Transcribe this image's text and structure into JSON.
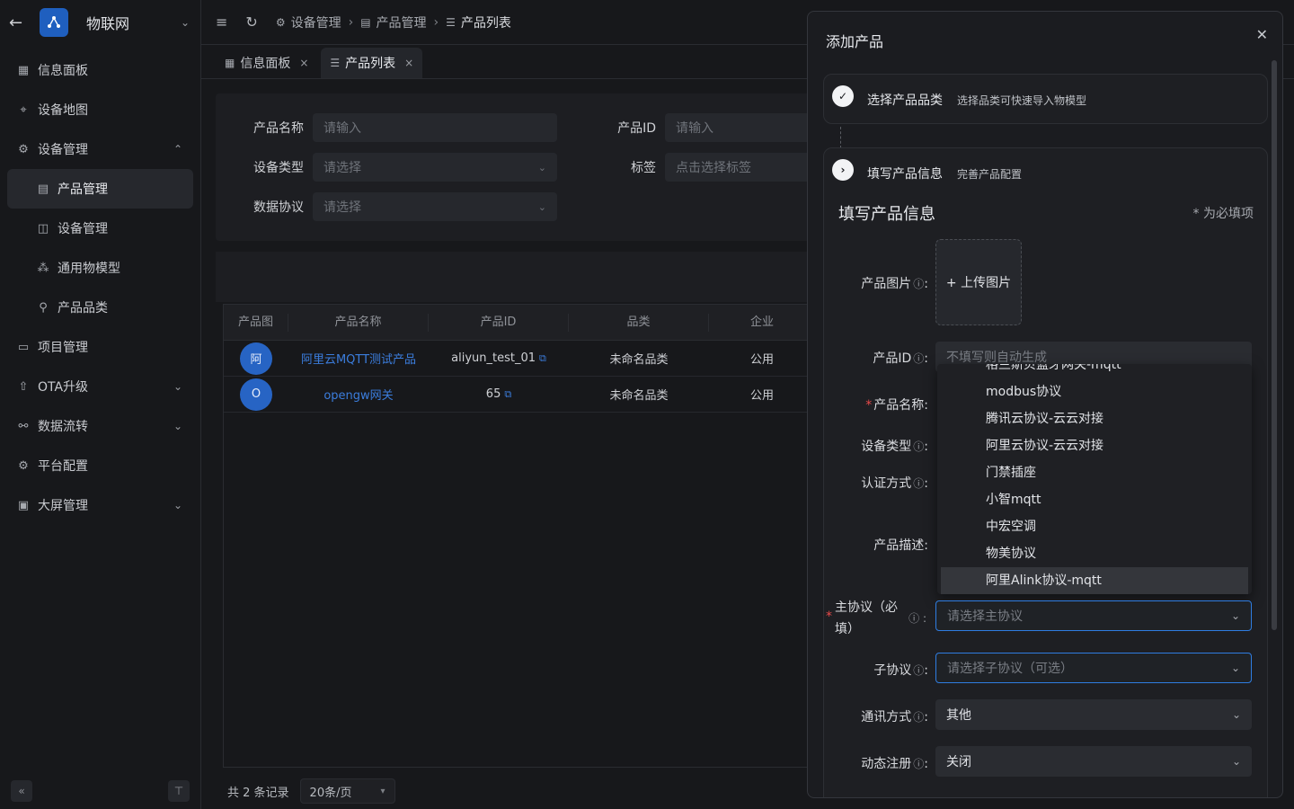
{
  "app": {
    "name": "物联网"
  },
  "sidebar": {
    "items": [
      {
        "label": "信息面板",
        "icon": "dashboard-icon"
      },
      {
        "label": "设备地图",
        "icon": "map-icon"
      },
      {
        "label": "设备管理",
        "icon": "gear-icon"
      },
      {
        "label": "产品管理",
        "icon": "product-icon"
      },
      {
        "label": "设备管理",
        "icon": "device-icon"
      },
      {
        "label": "通用物模型",
        "icon": "model-icon"
      },
      {
        "label": "产品品类",
        "icon": "category-icon"
      },
      {
        "label": "项目管理",
        "icon": "briefcase-icon"
      },
      {
        "label": "OTA升级",
        "icon": "upgrade-icon"
      },
      {
        "label": "数据流转",
        "icon": "flow-icon"
      },
      {
        "label": "平台配置",
        "icon": "settings-icon"
      },
      {
        "label": "大屏管理",
        "icon": "screen-icon"
      }
    ]
  },
  "breadcrumb": {
    "level1": "设备管理",
    "level2": "产品管理",
    "level3": "产品列表"
  },
  "tabs": [
    {
      "label": "信息面板"
    },
    {
      "label": "产品列表"
    }
  ],
  "filter": {
    "name_label": "产品名称",
    "name_ph": "请输入",
    "id_label": "产品ID",
    "id_ph": "请输入",
    "type_label": "设备类型",
    "type_ph": "请选择",
    "tag_label": "标签",
    "tag_ph": "点击选择标签",
    "proto_label": "数据协议",
    "proto_ph": "请选择"
  },
  "table": {
    "headers": [
      "产品图",
      "产品名称",
      "产品ID",
      "品类",
      "企业"
    ],
    "rows": [
      {
        "avatar": "阿",
        "name": "阿里云MQTT测试产品",
        "id": "aliyun_test_01",
        "category": "未命名品类",
        "org": "公用"
      },
      {
        "avatar": "O",
        "name": "opengw网关",
        "id": "65",
        "category": "未命名品类",
        "org": "公用"
      }
    ]
  },
  "pager": {
    "total": "共 2 条记录",
    "size": "20条/页"
  },
  "modal": {
    "title": "添加产品",
    "step1": {
      "title": "选择产品品类",
      "desc": "选择品类可快速导入物模型"
    },
    "step2": {
      "title": "填写产品信息",
      "desc": "完善产品配置"
    },
    "section_title": "填写产品信息",
    "required_note": "* 为必填项",
    "fields": {
      "image_label": "产品图片",
      "upload_label": "+ 上传图片",
      "id_label": "产品ID",
      "id_ph": "不填写则自动生成",
      "name_label": "产品名称",
      "type_label": "设备类型",
      "auth_label": "认证方式",
      "desc_label": "产品描述",
      "main_proto_label_a": "主协议（必",
      "main_proto_label_b": "填）",
      "main_proto_ph": "请选择主协议",
      "sub_proto_label": "子协议",
      "sub_proto_ph": "请选择子协议（可选）",
      "comm_label": "通讯方式",
      "comm_value": "其他",
      "dyn_label": "动态注册",
      "dyn_value": "关闭"
    },
    "dropdown": [
      "格兰斯贝蓝牙网关-mqtt",
      "modbus协议",
      "腾讯云协议-云云对接",
      "阿里云协议-云云对接",
      "门禁插座",
      "小智mqtt",
      "中宏空调",
      "物美协议",
      "阿里Alink协议-mqtt"
    ]
  }
}
